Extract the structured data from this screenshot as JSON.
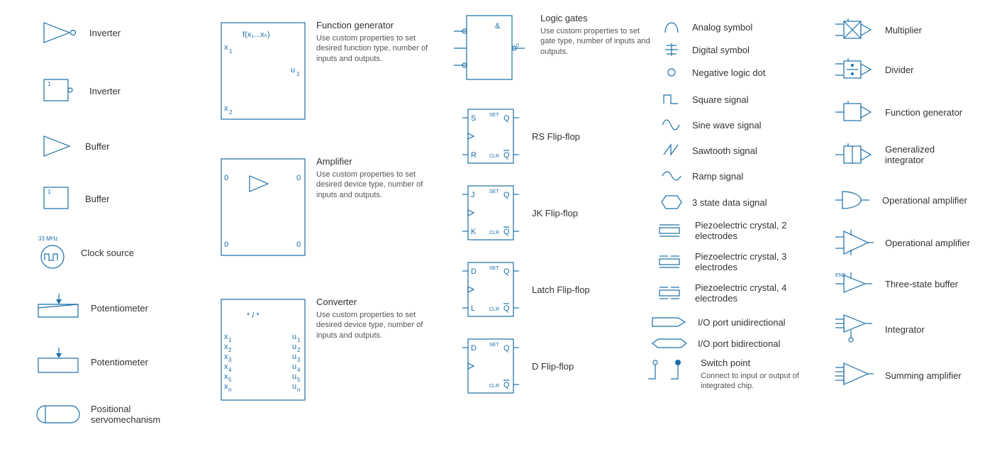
{
  "col1": {
    "inverter1": "Inverter",
    "inverter2": "Inverter",
    "buffer1": "Buffer",
    "buffer2": "Buffer",
    "clock": "Clock source",
    "clock_freq": "33 MHz",
    "pot1": "Potentiometer",
    "pot2": "Potentiometer",
    "servo": "Positional servomechanism",
    "box_num": "1"
  },
  "col2": {
    "fg_title": "Function generator",
    "fg_desc": "Use custom properties to set desired function type, number of inputs and outputs.",
    "fg_x1": "x",
    "fg_x1s": "1",
    "fg_x2": "x",
    "fg_x2s": "2",
    "fg_u1": "u",
    "fg_u1s": "1",
    "fg_expr": "f(x₁...xₙ)",
    "amp_title": "Amplifier",
    "amp_desc": "Use custom properties to set desired device type, number of inputs and outputs.",
    "amp_0": "0",
    "conv_title": "Converter",
    "conv_desc": "Use custom properties to set desired device type, number of inputs and outputs.",
    "conv_star": "* / *",
    "conv_x": "x",
    "conv_u": "u"
  },
  "col3": {
    "logic_title": "Logic gates",
    "logic_desc": "Use custom properties to set gate type, number of inputs and outputs.",
    "logic_amp": "&",
    "rs_title": "RS Flip-flop",
    "jk_title": "JK Flip-flop",
    "latch_title": "Latch Flip-flop",
    "d_title": "D Flip-flop",
    "ff": {
      "S": "S",
      "R": "R",
      "J": "J",
      "K": "K",
      "D": "D",
      "L": "L",
      "Q": "Q",
      "SET": "SET",
      "CLR": "CLR"
    }
  },
  "col4": {
    "analog": "Analog symbol",
    "digital": "Digital symbol",
    "negdot": "Negative logic dot",
    "square": "Square signal",
    "sine": "Sine wave signal",
    "saw": "Sawtooth signal",
    "ramp": "Ramp signal",
    "threestate": "3 state data signal",
    "piezo2": "Piezoelectric crystal, 2 electrodes",
    "piezo3": "Piezoelectric crystal, 3 electrodes",
    "piezo4": "Piezoelectric crystal, 4 electrodes",
    "io_uni": "I/O port unidirectional",
    "io_bi": "I/O port bidirectional",
    "switch_title": "Switch point",
    "switch_desc": "Connect to input or output of integrated chip."
  },
  "col5": {
    "mult": "Multiplier",
    "div": "Divider",
    "fg": "Function generator",
    "gi": "Generalized integrator",
    "oa1": "Operational amplifier",
    "oa2": "Operational amplifier",
    "tsb": "Three-state buffer",
    "tsb_enb": "ENB",
    "int": "Integrator",
    "sum": "Summing amplifier"
  }
}
